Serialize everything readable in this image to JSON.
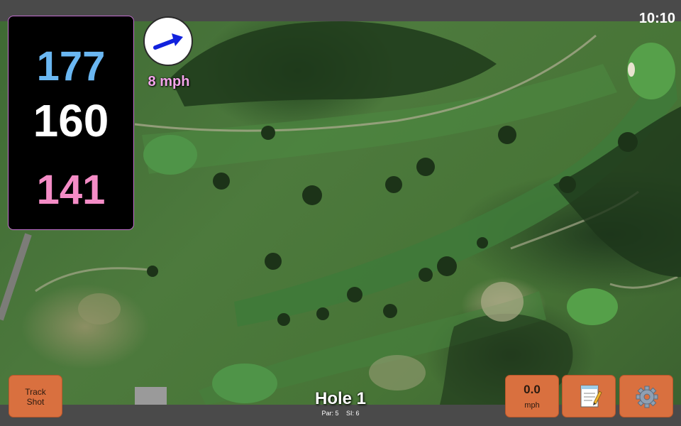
{
  "status": {
    "time": "10:10"
  },
  "distances": {
    "back": "177",
    "middle": "160",
    "front": "141"
  },
  "wind": {
    "speed_label": "8 mph",
    "arrow_icon": "wind-arrow-icon",
    "arrow_color": "#1122dd"
  },
  "buttons": {
    "track_shot": "Track\nShot",
    "speed_value": "0.0",
    "speed_unit": "mph",
    "notes_icon": "notepad-icon",
    "settings_icon": "gear-icon"
  },
  "hole": {
    "title": "Hole 1",
    "par": "Par: 5",
    "si": "SI: 6"
  },
  "colors": {
    "back_yardage": "#6ab7f2",
    "middle_yardage": "#ffffff",
    "front_yardage": "#f48cc6",
    "button_accent": "#d9703f"
  }
}
